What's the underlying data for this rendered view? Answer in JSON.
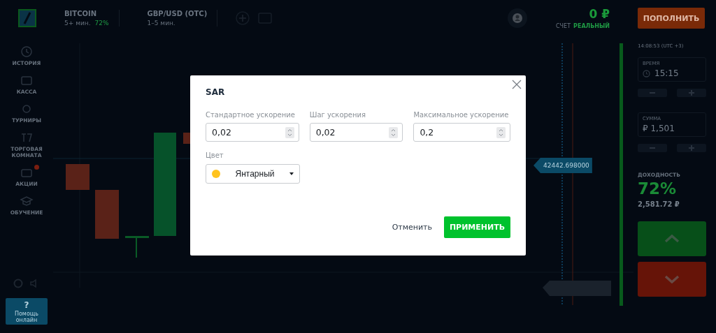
{
  "topbar": {
    "assets": [
      {
        "name": "BITCOIN",
        "duration": "5+ мин.",
        "payout": "72%"
      },
      {
        "name": "GBP/USD (OTC)",
        "duration": "1–5 мин."
      }
    ],
    "balance": "0 ₽",
    "account_label": "СЧЕТ",
    "account_type": "РЕАЛЬНЫЙ",
    "deposit_button": "ПОПОЛНИТЬ"
  },
  "sidebar": {
    "items": [
      {
        "kind": "history",
        "label": "ИСТОРИЯ"
      },
      {
        "kind": "cashier",
        "label": "КАССА"
      },
      {
        "kind": "tournaments",
        "label": "ТУРНИРЫ"
      },
      {
        "kind": "room",
        "label": "ТОРГОВАЯ КОМНАТА"
      },
      {
        "kind": "promo",
        "label": "АКЦИИ"
      },
      {
        "kind": "education",
        "label": "ОБУЧЕНИЕ"
      }
    ],
    "help_button": "Помощь онлайн",
    "help_mark": "?"
  },
  "chart": {
    "price_tag": "42442.698000"
  },
  "trade_panel": {
    "server_time": "14:08:53 (UTC +3)",
    "time_label": "ВРЕМЯ",
    "time_value": "15:15",
    "amount_label": "СУММА",
    "currency": "₽",
    "amount_value": "1,501",
    "payout_label": "ДОХОДНОСТЬ",
    "payout": "72%",
    "profit": "2,581.72 ₽"
  },
  "dialog": {
    "title": "SAR",
    "fields": [
      {
        "label": "Стандартное ускорение",
        "value": "0,02"
      },
      {
        "label": "Шаг ускорения",
        "value": "0,02"
      },
      {
        "label": "Максимальное ускорение",
        "value": "0,2"
      }
    ],
    "color_label": "Цвет",
    "color": {
      "name": "Янтарный",
      "color": "#ffc31f"
    },
    "cancel_button": "Отменить",
    "apply_button": "ПРИМЕНИТЬ"
  }
}
